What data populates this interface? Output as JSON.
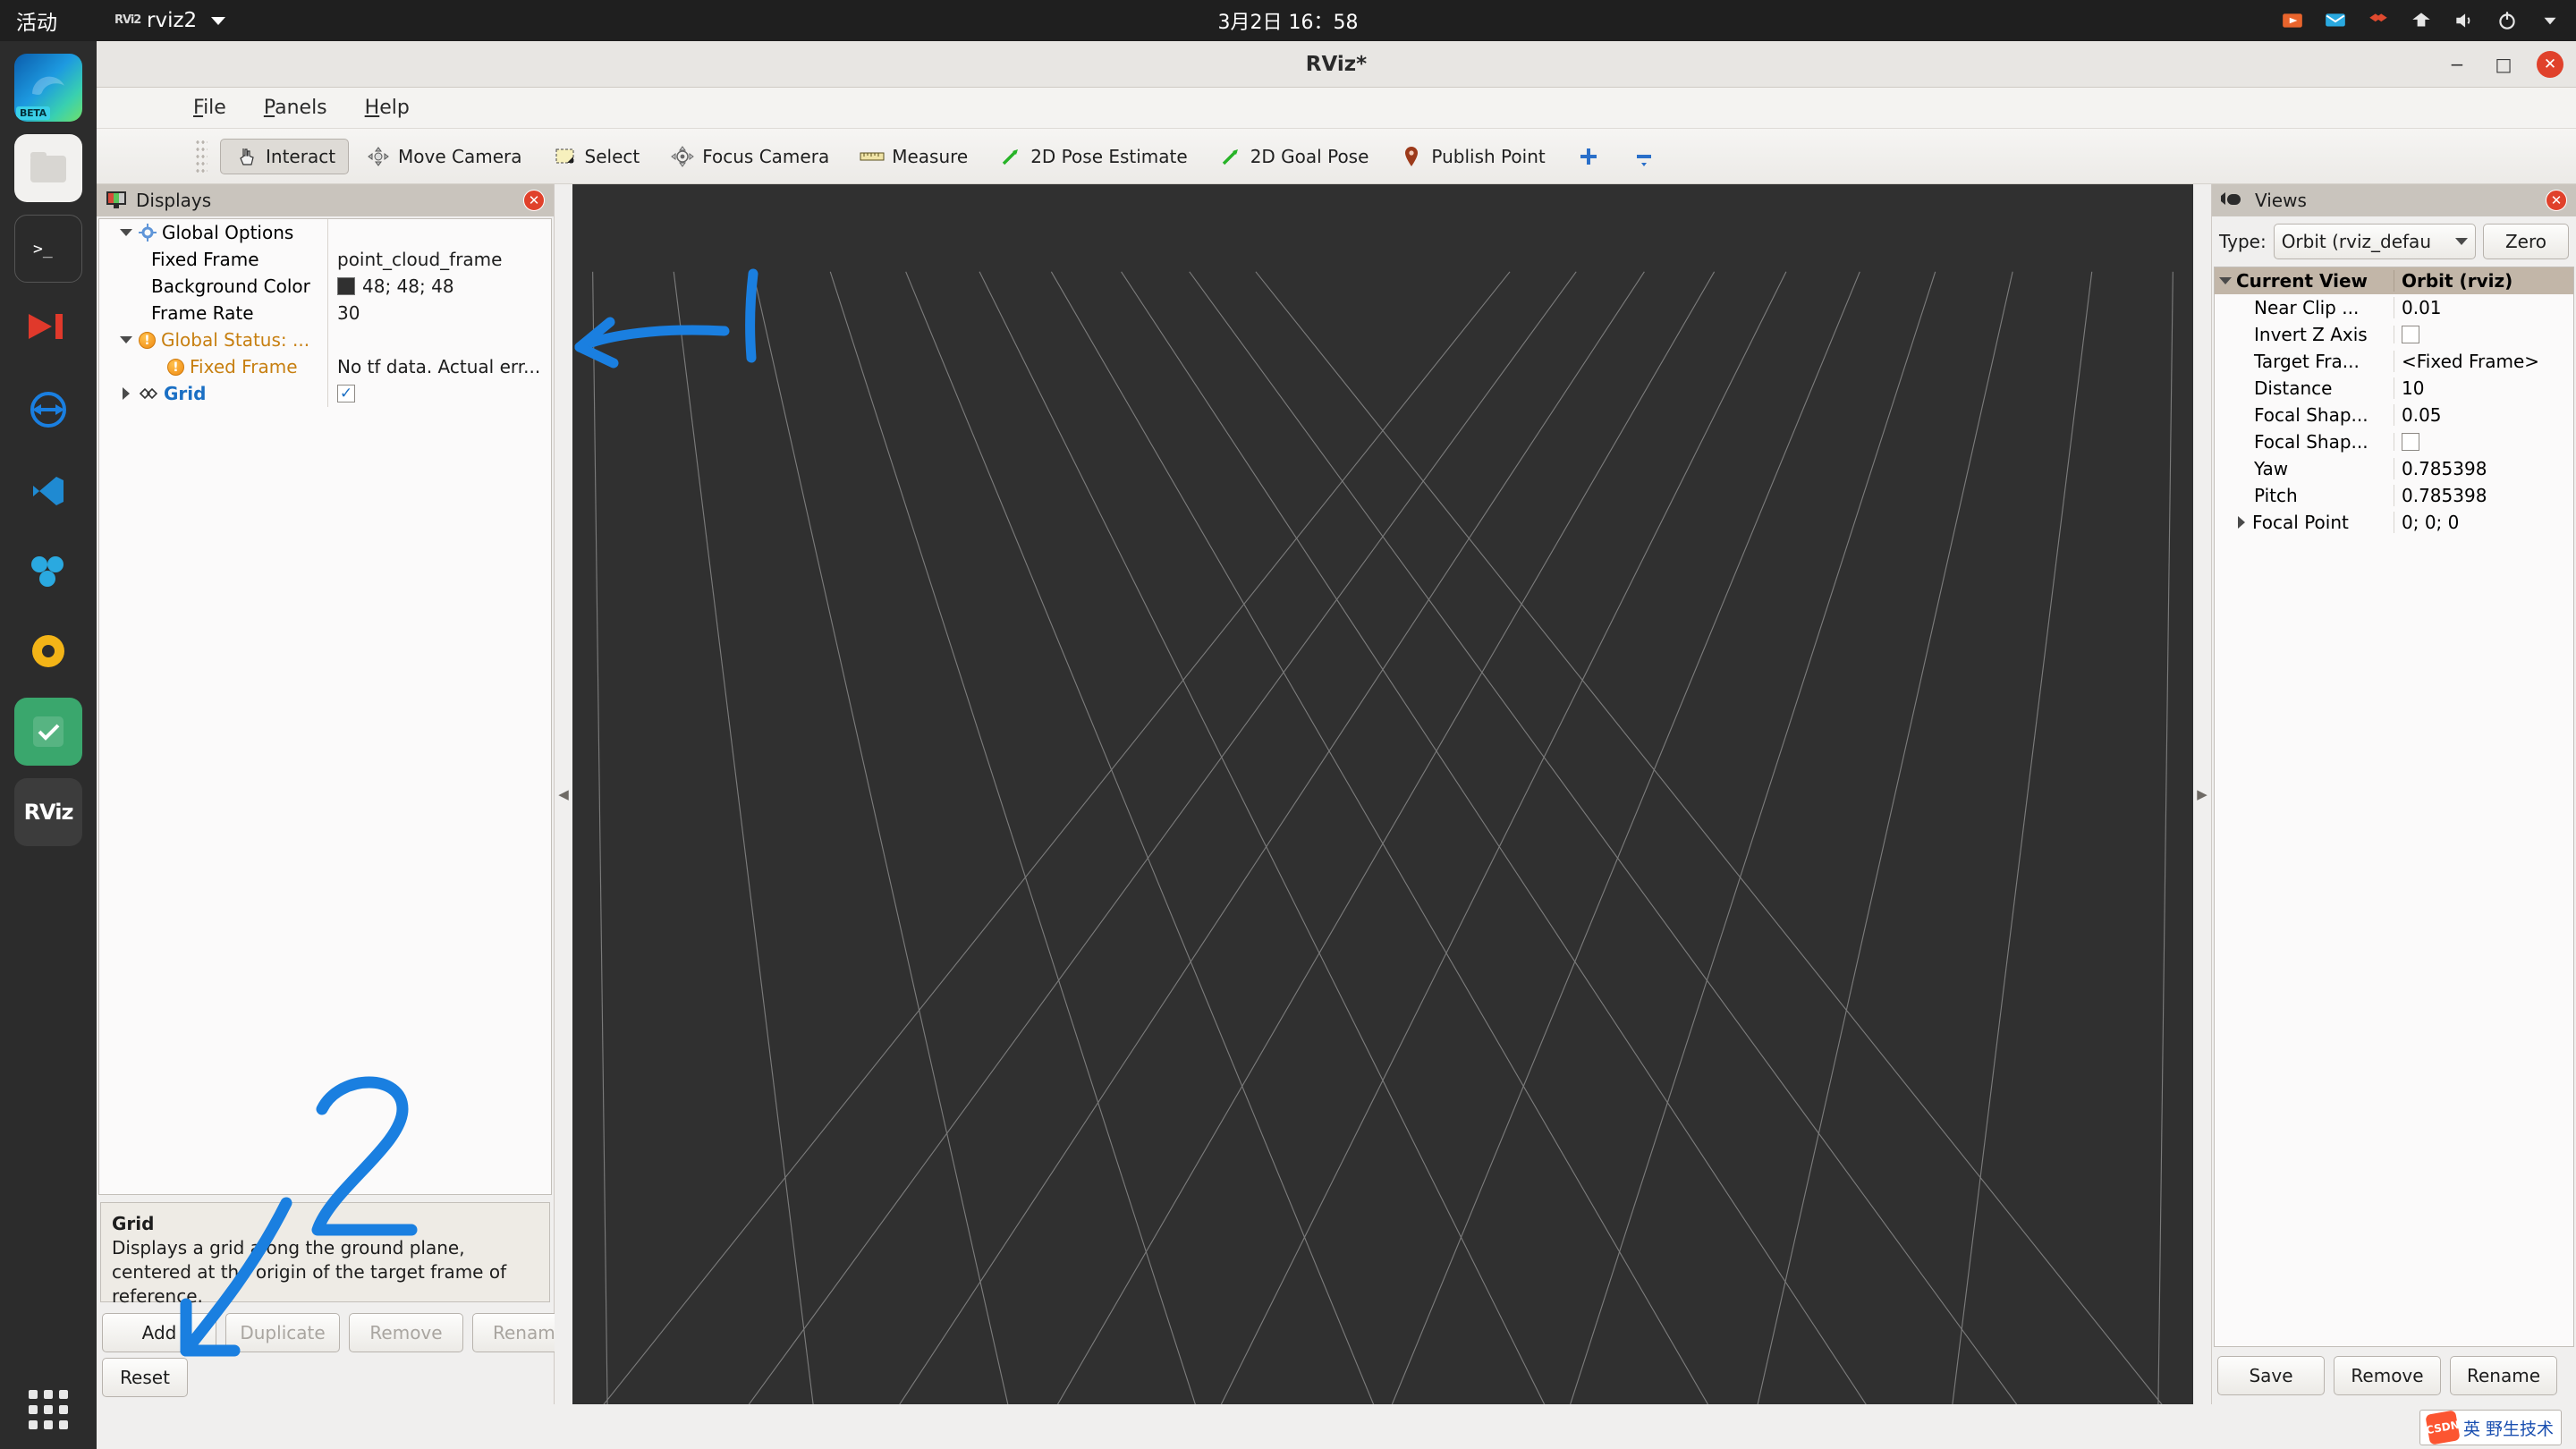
{
  "desktop": {
    "activities": "活动",
    "app_icon": "rviz-icon",
    "app_name": "rviz2",
    "clock": "3月2日  16：58",
    "tray_icons": [
      "screencast-icon",
      "message-icon",
      "dropbox-icon",
      "network-icon",
      "volume-icon",
      "power-icon",
      "chevron-down-icon"
    ]
  },
  "dock": {
    "items": [
      {
        "name": "firefox-beta",
        "badge": "BETA"
      },
      {
        "name": "files"
      },
      {
        "name": "terminal"
      },
      {
        "name": "ros-rqt"
      },
      {
        "name": "teamviewer"
      },
      {
        "name": "vscode"
      },
      {
        "name": "gazebo"
      },
      {
        "name": "ubuntu-software"
      },
      {
        "name": "todo-app"
      },
      {
        "name": "rviz",
        "label": "RViz"
      }
    ],
    "show_apps": "show-applications"
  },
  "window": {
    "title": "RViz*",
    "minimize": "−",
    "maximize": "□",
    "close": "✕"
  },
  "menubar": {
    "items": [
      {
        "label": "File",
        "mnemonic": "F"
      },
      {
        "label": "Panels",
        "mnemonic": "P"
      },
      {
        "label": "Help",
        "mnemonic": "H"
      }
    ]
  },
  "toolbar": {
    "buttons": [
      {
        "label": "Interact",
        "icon": "hand-cursor-icon",
        "checked": true
      },
      {
        "label": "Move Camera",
        "icon": "move-camera-icon",
        "checked": false
      },
      {
        "label": "Select",
        "icon": "select-rect-icon",
        "checked": false
      },
      {
        "label": "Focus Camera",
        "icon": "focus-camera-icon",
        "checked": false
      },
      {
        "label": "Measure",
        "icon": "ruler-icon",
        "checked": false
      },
      {
        "label": "2D Pose Estimate",
        "icon": "green-arrow-icon",
        "checked": false
      },
      {
        "label": "2D Goal Pose",
        "icon": "green-arrow-icon",
        "checked": false
      },
      {
        "label": "Publish Point",
        "icon": "map-pin-icon",
        "checked": false
      }
    ],
    "extra": [
      {
        "label": "",
        "icon": "plus-icon"
      },
      {
        "label": "",
        "icon": "minus-icon"
      }
    ]
  },
  "displays": {
    "panel_title": "Displays",
    "panel_icon": "monitor-icon",
    "close_label": "✕",
    "rows": [
      {
        "indent": 1,
        "arrow": "down",
        "icon": "gear-icon",
        "name": "Global Options",
        "value": "",
        "value_type": "none",
        "style": "normal"
      },
      {
        "indent": 2,
        "arrow": "none",
        "icon": "none",
        "name": "Fixed Frame",
        "value": "point_cloud_frame",
        "value_type": "text",
        "style": "normal"
      },
      {
        "indent": 2,
        "arrow": "none",
        "icon": "none",
        "name": "Background Color",
        "value": "48; 48; 48",
        "value_type": "color",
        "color": "#303030",
        "style": "normal"
      },
      {
        "indent": 2,
        "arrow": "none",
        "icon": "none",
        "name": "Frame Rate",
        "value": "30",
        "value_type": "text",
        "style": "normal"
      },
      {
        "indent": 1,
        "arrow": "down",
        "icon": "warn-icon",
        "name": "Global Status: ...",
        "value": "",
        "value_type": "none",
        "style": "warn"
      },
      {
        "indent": 3,
        "arrow": "none",
        "icon": "warn-icon",
        "name": "Fixed Frame",
        "value": "No tf data.  Actual err...",
        "value_type": "text",
        "style": "warn"
      },
      {
        "indent": 1,
        "arrow": "right",
        "icon": "grid-icon",
        "name": "Grid",
        "value": "",
        "value_type": "check",
        "checked": true,
        "style": "link"
      }
    ],
    "help": {
      "title": "Grid",
      "body": "Displays a grid along the ground plane, centered at the origin of the target frame of reference."
    },
    "buttons": [
      {
        "label": "Add",
        "enabled": true
      },
      {
        "label": "Duplicate",
        "enabled": false
      },
      {
        "label": "Remove",
        "enabled": false
      },
      {
        "label": "Rename",
        "enabled": false
      }
    ],
    "reset_button": {
      "label": "Reset",
      "enabled": true
    }
  },
  "views": {
    "panel_title": "Views",
    "panel_icon": "camera-icon",
    "close_label": "✕",
    "type_label": "Type:",
    "type_value": "Orbit (rviz_defau",
    "zero_button": "Zero",
    "header": {
      "name": "Current View",
      "value": "Orbit (rviz)"
    },
    "rows": [
      {
        "name": "Near Clip ...",
        "value": "0.01",
        "type": "text"
      },
      {
        "name": "Invert Z Axis",
        "value": "",
        "type": "check",
        "checked": false
      },
      {
        "name": "Target Fra...",
        "value": "<Fixed Frame>",
        "type": "text"
      },
      {
        "name": "Distance",
        "value": "10",
        "type": "text"
      },
      {
        "name": "Focal Shap...",
        "value": "0.05",
        "type": "text"
      },
      {
        "name": "Focal Shap...",
        "value": "",
        "type": "check",
        "checked": false
      },
      {
        "name": "Yaw",
        "value": "0.785398",
        "type": "text"
      },
      {
        "name": "Pitch",
        "value": "0.785398",
        "type": "text"
      },
      {
        "name": "Focal Point",
        "value": "0; 0; 0",
        "type": "text",
        "arrow": "right"
      }
    ],
    "buttons": [
      {
        "label": "Save"
      },
      {
        "label": "Remove"
      },
      {
        "label": "Rename"
      }
    ]
  },
  "viewport": {
    "background_color": "#303030",
    "grid_color": "#8a8a8a",
    "annotation_color": "#1a7fe0",
    "annotations": [
      {
        "name": "arrow-to-fixed-frame",
        "label": "1"
      },
      {
        "name": "arrow-to-grid-help",
        "label": "2"
      }
    ]
  },
  "statusbar": {
    "ime_text": "英 野生技术",
    "watermark": "CSDN"
  }
}
